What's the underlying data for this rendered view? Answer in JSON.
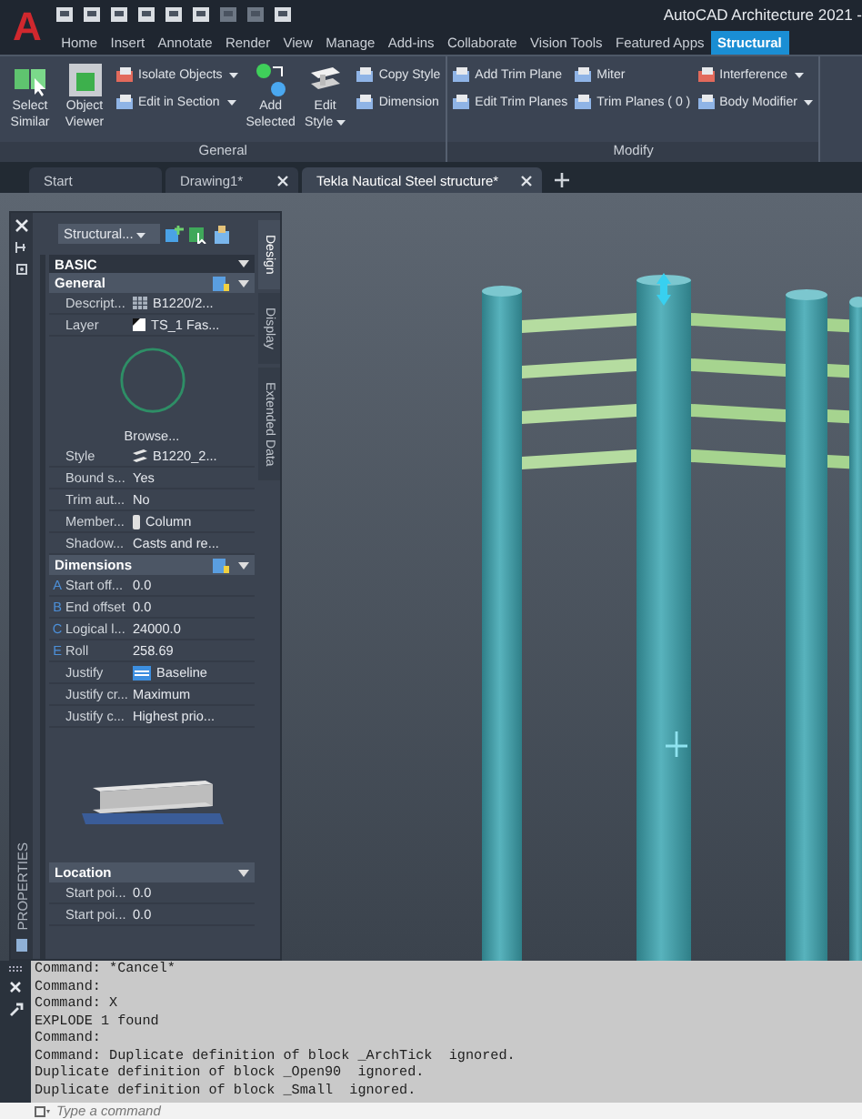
{
  "app": {
    "logo": "A",
    "title": "AutoCAD Architecture 2021 -"
  },
  "menu_tabs": [
    {
      "label": "Home",
      "selected": false
    },
    {
      "label": "Insert",
      "selected": false
    },
    {
      "label": "Annotate",
      "selected": false
    },
    {
      "label": "Render",
      "selected": false
    },
    {
      "label": "View",
      "selected": false
    },
    {
      "label": "Manage",
      "selected": false
    },
    {
      "label": "Add-ins",
      "selected": false
    },
    {
      "label": "Collaborate",
      "selected": false
    },
    {
      "label": "Vision Tools",
      "selected": false
    },
    {
      "label": "Featured Apps",
      "selected": false
    },
    {
      "label": "Structural",
      "selected": true
    }
  ],
  "ribbon": [
    {
      "title": "General",
      "groups": [
        {
          "kind": "large",
          "tools": [
            {
              "label": "Select Similar",
              "kind": "select-similar",
              "dropdown": false
            },
            {
              "label": "Object Viewer",
              "kind": "object-viewer",
              "dropdown": false
            }
          ]
        },
        {
          "kind": "small",
          "tools": [
            {
              "label": "Isolate Objects",
              "kind": "isolate",
              "dropdown": true
            },
            {
              "label": "Edit in Section",
              "kind": "section",
              "dropdown": true
            }
          ]
        },
        {
          "kind": "large",
          "tools": [
            {
              "label": "Add Selected",
              "kind": "add-selected",
              "dropdown": false
            },
            {
              "label": "Edit Style",
              "kind": "edit-style",
              "dropdown": true
            }
          ]
        },
        {
          "kind": "small",
          "tools": [
            {
              "label": "Copy Style",
              "kind": "copy-style",
              "dropdown": false
            },
            {
              "label": "Dimension",
              "kind": "dimension",
              "dropdown": false
            }
          ]
        }
      ]
    },
    {
      "title": "Modify",
      "groups": [
        {
          "kind": "small",
          "tools": [
            {
              "label": "Add Trim Plane",
              "kind": "trim",
              "dropdown": false
            },
            {
              "label": "Edit Trim Planes",
              "kind": "edit-trim",
              "dropdown": false
            }
          ]
        },
        {
          "kind": "small",
          "tools": [
            {
              "label": "Miter",
              "kind": "miter",
              "dropdown": false
            },
            {
              "label": "Trim Planes ( 0 )",
              "kind": "trim-planes",
              "dropdown": false
            }
          ]
        },
        {
          "kind": "small",
          "tools": [
            {
              "label": "Interference",
              "kind": "interference",
              "dropdown": true
            },
            {
              "label": "Body Modifier",
              "kind": "body",
              "dropdown": true
            }
          ]
        }
      ]
    }
  ],
  "doc_tabs": [
    {
      "label": "Start",
      "selected": false,
      "closable": false
    },
    {
      "label": "Drawing1*",
      "selected": false,
      "closable": true
    },
    {
      "label": "Tekla Nautical Steel structure*",
      "selected": true,
      "closable": true
    }
  ],
  "palette": {
    "title": "PROPERTIES",
    "selector": "Structural...",
    "category": "BASIC",
    "side_tabs": [
      {
        "label": "Design",
        "selected": true
      },
      {
        "label": "Display",
        "selected": false
      },
      {
        "label": "Extended Data",
        "selected": false
      }
    ],
    "sections": [
      {
        "title": "General",
        "select_button": true,
        "items": [
          {
            "kind": "description-row",
            "label": "Descript...",
            "value": "B1220/2..."
          },
          {
            "kind": "layer-row",
            "label": "Layer",
            "value": "TS_1 Fas..."
          },
          {
            "kind": "circle-preview"
          },
          {
            "kind": "link",
            "label": "Browse..."
          },
          {
            "kind": "style-row",
            "label": "Style",
            "value": "B1220_2..."
          },
          {
            "kind": "text-row",
            "label": "Bound s...",
            "value": "Yes"
          },
          {
            "kind": "text-row",
            "label": "Trim aut...",
            "value": "No"
          },
          {
            "kind": "member-row",
            "label": "Member...",
            "value": "Column"
          },
          {
            "kind": "text-row",
            "label": "Shadow...",
            "value": "Casts and re..."
          }
        ]
      },
      {
        "title": "Dimensions",
        "select_button": true,
        "items": [
          {
            "kind": "text-row",
            "marker": "A",
            "label": "Start off...",
            "value": "0.0"
          },
          {
            "kind": "text-row",
            "marker": "B",
            "label": "End offset",
            "value": "0.0"
          },
          {
            "kind": "text-row",
            "marker": "C",
            "label": "Logical l...",
            "value": "24000.0"
          },
          {
            "kind": "text-row",
            "marker": "E",
            "label": "Roll",
            "value": "258.69"
          },
          {
            "kind": "justify-row",
            "label": "Justify",
            "value": "Baseline"
          },
          {
            "kind": "text-row",
            "label": "Justify cr...",
            "value": "Maximum"
          },
          {
            "kind": "text-row",
            "label": "Justify c...",
            "value": "Highest prio..."
          },
          {
            "kind": "beam-preview"
          }
        ]
      },
      {
        "title": "Location",
        "select_button": false,
        "items": [
          {
            "kind": "text-row",
            "label": "Start poi...",
            "value": "0.0"
          },
          {
            "kind": "text-row",
            "label": "Start poi...",
            "value": "0.0"
          }
        ]
      }
    ]
  },
  "command": {
    "lines": [
      "Command: *Cancel*",
      "Command:",
      "Command: X",
      "EXPLODE 1 found",
      "Command:",
      "Command: Duplicate definition of block _ArchTick  ignored.",
      "Duplicate definition of block _Open90  ignored.",
      "Duplicate definition of block _Small  ignored."
    ],
    "placeholder": "Type a command"
  }
}
